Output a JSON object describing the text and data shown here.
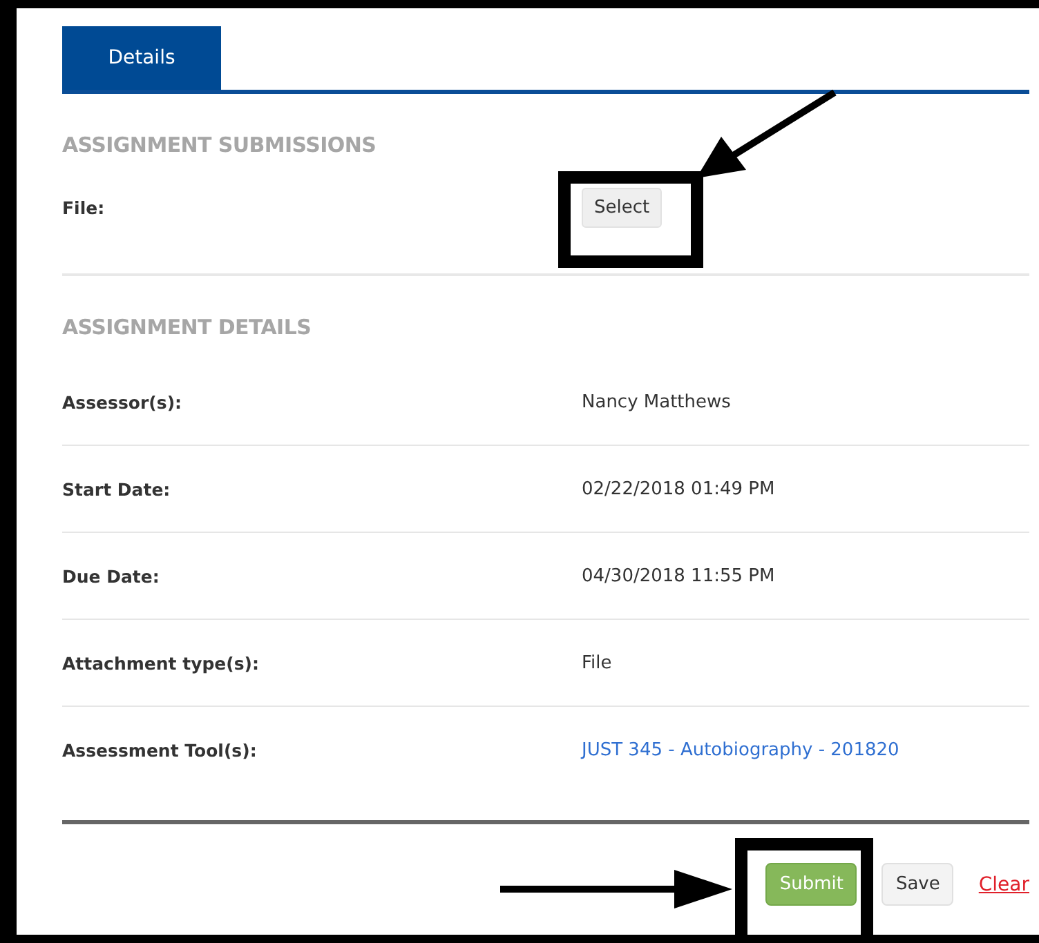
{
  "tabs": [
    {
      "label": "Details",
      "selected": true
    }
  ],
  "submission": {
    "heading": "ASSIGNMENT SUBMISSIONS",
    "file_label": "File:",
    "select_button": "Select"
  },
  "details": {
    "heading": "ASSIGNMENT DETAILS",
    "rows": [
      {
        "label": "Assessor(s):",
        "value": "Nancy Matthews",
        "kind": "text"
      },
      {
        "label": "Start Date:",
        "value": "02/22/2018 01:49 PM",
        "kind": "text"
      },
      {
        "label": "Due Date:",
        "value": "04/30/2018 11:55 PM",
        "kind": "text"
      },
      {
        "label": "Attachment type(s):",
        "value": "File",
        "kind": "text"
      },
      {
        "label": "Assessment Tool(s):",
        "value": "JUST 345 - Autobiography - 201820",
        "kind": "link"
      }
    ]
  },
  "actions": [
    {
      "label": "Submit",
      "kind": "primary"
    },
    {
      "label": "Save",
      "kind": "secondary"
    },
    {
      "label": "Clear",
      "kind": "link"
    }
  ]
}
